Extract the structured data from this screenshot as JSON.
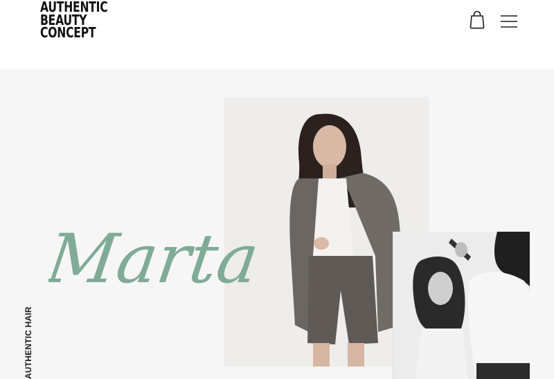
{
  "brand": {
    "logo_lines": [
      "AUTHENTIC",
      "BEAUTY",
      "CONCEPT"
    ]
  },
  "header": {
    "icons": {
      "bag": "shopping-bag-icon",
      "menu": "hamburger-menu-icon"
    }
  },
  "hero": {
    "name": "Marta",
    "side_label": "AUTHENTIC HAIR",
    "images": [
      "portrait-photo",
      "salon-photo"
    ]
  },
  "colors": {
    "accent": "#7fab97",
    "background": "#f7f6f6",
    "text": "#111111"
  }
}
